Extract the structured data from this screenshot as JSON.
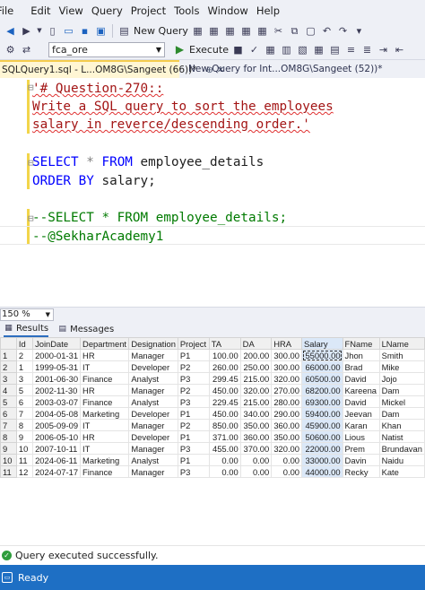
{
  "menu": [
    "File",
    "Edit",
    "View",
    "Query",
    "Project",
    "Tools",
    "Window",
    "Help"
  ],
  "toolbar": {
    "new_query_label": "New Query",
    "database": "fca_ore",
    "execute_label": "Execute"
  },
  "tabs": [
    {
      "label": "SQLQuery1.sql - L...OM8G\\Sangeet (66))*"
    },
    {
      "label": "New Query for Int...OM8G\\Sangeet (52))*"
    }
  ],
  "editor": {
    "lines": {
      "l1": "'# Question-270::",
      "l2": "Write a SQL query to sort the employees",
      "l3": "salary in reverce/descending order.'",
      "l5_kw1": "SELECT",
      "l5_op": " * ",
      "l5_kw2": "FROM",
      "l5_rest": " employee_details",
      "l6_kw": "ORDER BY",
      "l6_rest": " salary;",
      "l8": "--SELECT * FROM employee_details;",
      "l9": "--@SekharAcademy1"
    }
  },
  "zoom": "150 %",
  "results_tabs": {
    "results": "Results",
    "messages": "Messages"
  },
  "grid": {
    "columns": [
      "Id",
      "JoinDate",
      "Department",
      "Designation",
      "Project",
      "TA",
      "DA",
      "HRA",
      "Salary",
      "FName",
      "LName"
    ],
    "rows": [
      [
        "1",
        "2",
        "2000-01-31",
        "HR",
        "Manager",
        "P1",
        "100.00",
        "200.00",
        "300.00",
        "55000.00",
        "Jhon",
        "Smith"
      ],
      [
        "2",
        "1",
        "1999-05-31",
        "IT",
        "Developer",
        "P2",
        "260.00",
        "250.00",
        "300.00",
        "66000.00",
        "Brad",
        "Mike"
      ],
      [
        "3",
        "3",
        "2001-06-30",
        "Finance",
        "Analyst",
        "P3",
        "299.45",
        "215.00",
        "320.00",
        "60500.00",
        "David",
        "Jojo"
      ],
      [
        "4",
        "5",
        "2002-11-30",
        "HR",
        "Manager",
        "P2",
        "450.00",
        "320.00",
        "270.00",
        "68200.00",
        "Kareena",
        "Dam"
      ],
      [
        "5",
        "6",
        "2003-03-07",
        "Finance",
        "Analyst",
        "P3",
        "229.45",
        "215.00",
        "280.00",
        "69300.00",
        "David",
        "Mickel"
      ],
      [
        "6",
        "7",
        "2004-05-08",
        "Marketing",
        "Developer",
        "P1",
        "450.00",
        "340.00",
        "290.00",
        "59400.00",
        "Jeevan",
        "Dam"
      ],
      [
        "7",
        "8",
        "2005-09-09",
        "IT",
        "Manager",
        "P2",
        "850.00",
        "350.00",
        "360.00",
        "45900.00",
        "Karan",
        "Khan"
      ],
      [
        "8",
        "9",
        "2006-05-10",
        "HR",
        "Developer",
        "P1",
        "371.00",
        "360.00",
        "350.00",
        "50600.00",
        "Lious",
        "Natist"
      ],
      [
        "9",
        "10",
        "2007-10-11",
        "IT",
        "Manager",
        "P3",
        "455.00",
        "370.00",
        "320.00",
        "22000.00",
        "Prem",
        "Brundavan"
      ],
      [
        "10",
        "11",
        "2024-06-11",
        "Marketing",
        "Analyst",
        "P1",
        "0.00",
        "0.00",
        "0.00",
        "33000.00",
        "Davin",
        "Naidu"
      ],
      [
        "11",
        "12",
        "2024-07-17",
        "Finance",
        "Manager",
        "P3",
        "0.00",
        "0.00",
        "0.00",
        "44000.00",
        "Recky",
        "Kate"
      ]
    ]
  },
  "query_status": "Query executed successfully.",
  "status_bar": "Ready"
}
